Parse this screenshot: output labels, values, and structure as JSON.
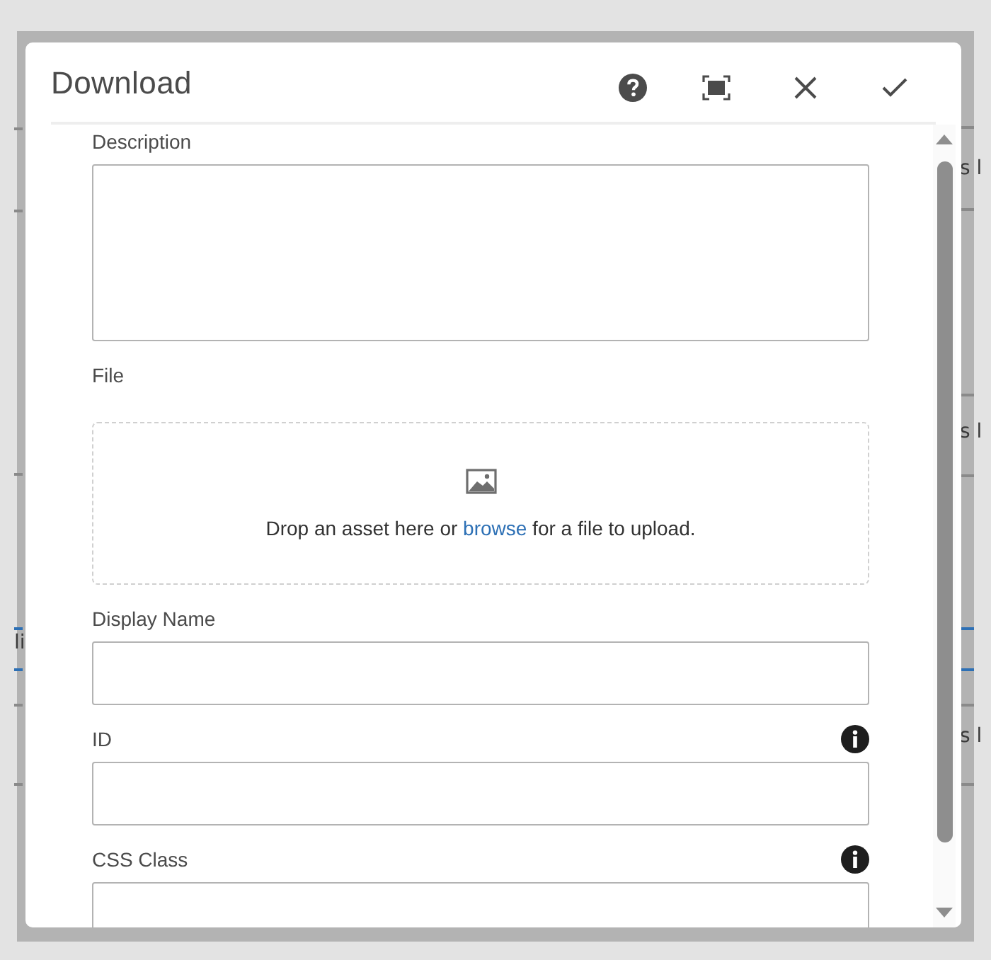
{
  "backdrop": {
    "left_fragments": [
      "li"
    ],
    "right_fragments": [
      "s l",
      "s l",
      "s l"
    ]
  },
  "dialog": {
    "title": "Download"
  },
  "fields": [
    {
      "kind": "textarea",
      "label": "Description",
      "info": false
    },
    {
      "kind": "dropzone",
      "label": "File",
      "text_before": "Drop an asset here or ",
      "link": "browse",
      "text_after": " for a file to upload."
    },
    {
      "kind": "input",
      "label": "Display Name",
      "info": false
    },
    {
      "kind": "input",
      "label": "ID",
      "info": true
    },
    {
      "kind": "input",
      "label": "CSS Class",
      "info": true
    }
  ]
}
